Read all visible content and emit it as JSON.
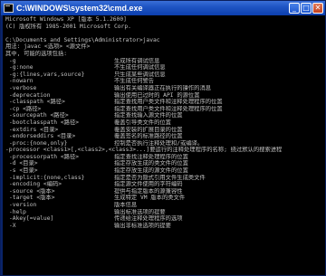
{
  "window": {
    "title": "C:\\WINDOWS\\system32\\cmd.exe",
    "minimize_glyph": "_",
    "maximize_glyph": "□",
    "close_glyph": "✕",
    "colors": {
      "titlebar": "#1f55c4",
      "console_bg": "#000000",
      "console_fg": "#c0c0c0"
    }
  },
  "console": {
    "header_lines": [
      "Microsoft Windows XP [版本 5.1.2600]",
      "(C) 版权所有 1985-2001 Microsoft Corp.",
      "",
      "C:\\Documents and Settings\\Administrator>javac",
      "用法: javac <选项> <源文件>",
      "其中, 可能的选项包括:"
    ],
    "options": [
      {
        "flag": "-g",
        "desc": "生成所有调试信息"
      },
      {
        "flag": "-g:none",
        "desc": "不生成任何调试信息"
      },
      {
        "flag": "-g:{lines,vars,source}",
        "desc": "只生成某些调试信息"
      },
      {
        "flag": "-nowarn",
        "desc": "不生成任何警告"
      },
      {
        "flag": "-verbose",
        "desc": "输出有关编译器正在执行的操作的消息"
      },
      {
        "flag": "-deprecation",
        "desc": "输出使用已过时的 API 的源位置"
      },
      {
        "flag": "-classpath <路径>",
        "desc": "指定查找用户类文件和注释处理程序的位置"
      },
      {
        "flag": "-cp <路径>",
        "desc": "指定查找用户类文件和注释处理程序的位置"
      },
      {
        "flag": "-sourcepath <路径>",
        "desc": "指定查找输入源文件的位置"
      },
      {
        "flag": "-bootclasspath <路径>",
        "desc": "覆盖引导类文件的位置"
      },
      {
        "flag": "-extdirs <目录>",
        "desc": "覆盖安装的扩展目录的位置"
      },
      {
        "flag": "-endorseddirs <目录>",
        "desc": "覆盖签名的标准路径的位置"
      },
      {
        "flag": "-proc:{none,only}",
        "desc": "控制是否执行注释处理和/或编译。"
      }
    ],
    "processor_wrap": "-processor <class1>[,<class2>,<class3>...]要运行的注释处理程序的名称; 绕过默认的搜索进程",
    "options2": [
      {
        "flag": "-processorpath <路径>",
        "desc": "指定查找注释处理程序的位置"
      },
      {
        "flag": "-d <目录>",
        "desc": "指定存放生成的类文件的位置"
      },
      {
        "flag": "-s <目录>",
        "desc": "指定存放生成的源文件的位置"
      },
      {
        "flag": "-implicit:{none,class}",
        "desc": "指定是否为隐式引用文件生成类文件"
      },
      {
        "flag": "-encoding <编码>",
        "desc": "指定源文件使用的字符编码"
      },
      {
        "flag": "-source <版本>",
        "desc": "提供与指定版本的源兼容性"
      },
      {
        "flag": "-target <版本>",
        "desc": "生成特定 VM 版本的类文件"
      },
      {
        "flag": "-version",
        "desc": "版本信息"
      },
      {
        "flag": "-help",
        "desc": "输出标准选项的提要"
      },
      {
        "flag": "-Akey[=value]",
        "desc": "传递给注释处理程序的选项"
      },
      {
        "flag": "-X",
        "desc": "输出非标准选项的提要"
      }
    ]
  }
}
